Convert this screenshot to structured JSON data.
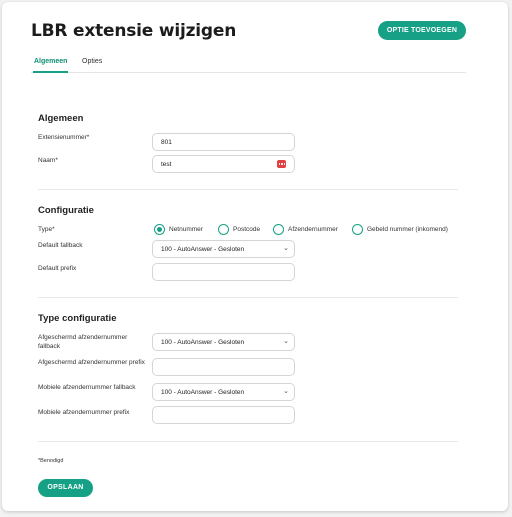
{
  "page": {
    "title": "LBR extensie wijzigen",
    "add_option_label": "OPTIE TOEVOEGEN"
  },
  "tabs": [
    {
      "label": "Algemeen",
      "active": true
    },
    {
      "label": "Opties",
      "active": false
    }
  ],
  "general": {
    "title": "Algemeen",
    "extension_number": {
      "label": "Extensienummer*",
      "value": "801"
    },
    "name": {
      "label": "Naam*",
      "value": "test"
    }
  },
  "configuration": {
    "title": "Configuratie",
    "type_label": "Type*",
    "type_options": [
      {
        "label": "Netnummer",
        "selected": true
      },
      {
        "label": "Postcode",
        "selected": false
      },
      {
        "label": "Afzendernummer",
        "selected": false
      },
      {
        "label": "Gebeld nummer (inkomend)",
        "selected": false
      }
    ],
    "default_fallback": {
      "label": "Default fallback",
      "value": "100 - AutoAnswer - Gesloten"
    },
    "default_prefix": {
      "label": "Default prefix",
      "value": ""
    }
  },
  "type_configuration": {
    "title": "Type configuratie",
    "shielded_fallback": {
      "label": "Afgeschermd afzendernummer fallback",
      "value": "100 - AutoAnswer - Gesloten"
    },
    "shielded_prefix": {
      "label": "Afgeschermd afzendernummer prefix",
      "value": ""
    },
    "mobile_fallback": {
      "label": "Mobiele afzendernummer fallback",
      "value": "100 - AutoAnswer - Gesloten"
    },
    "mobile_prefix": {
      "label": "Mobiele afzendernummer prefix",
      "value": ""
    }
  },
  "footer": {
    "required_note": "*Benodigd",
    "save_label": "OPSLAAN"
  },
  "colors": {
    "accent": "#16a085",
    "password_icon": "#e04040"
  }
}
